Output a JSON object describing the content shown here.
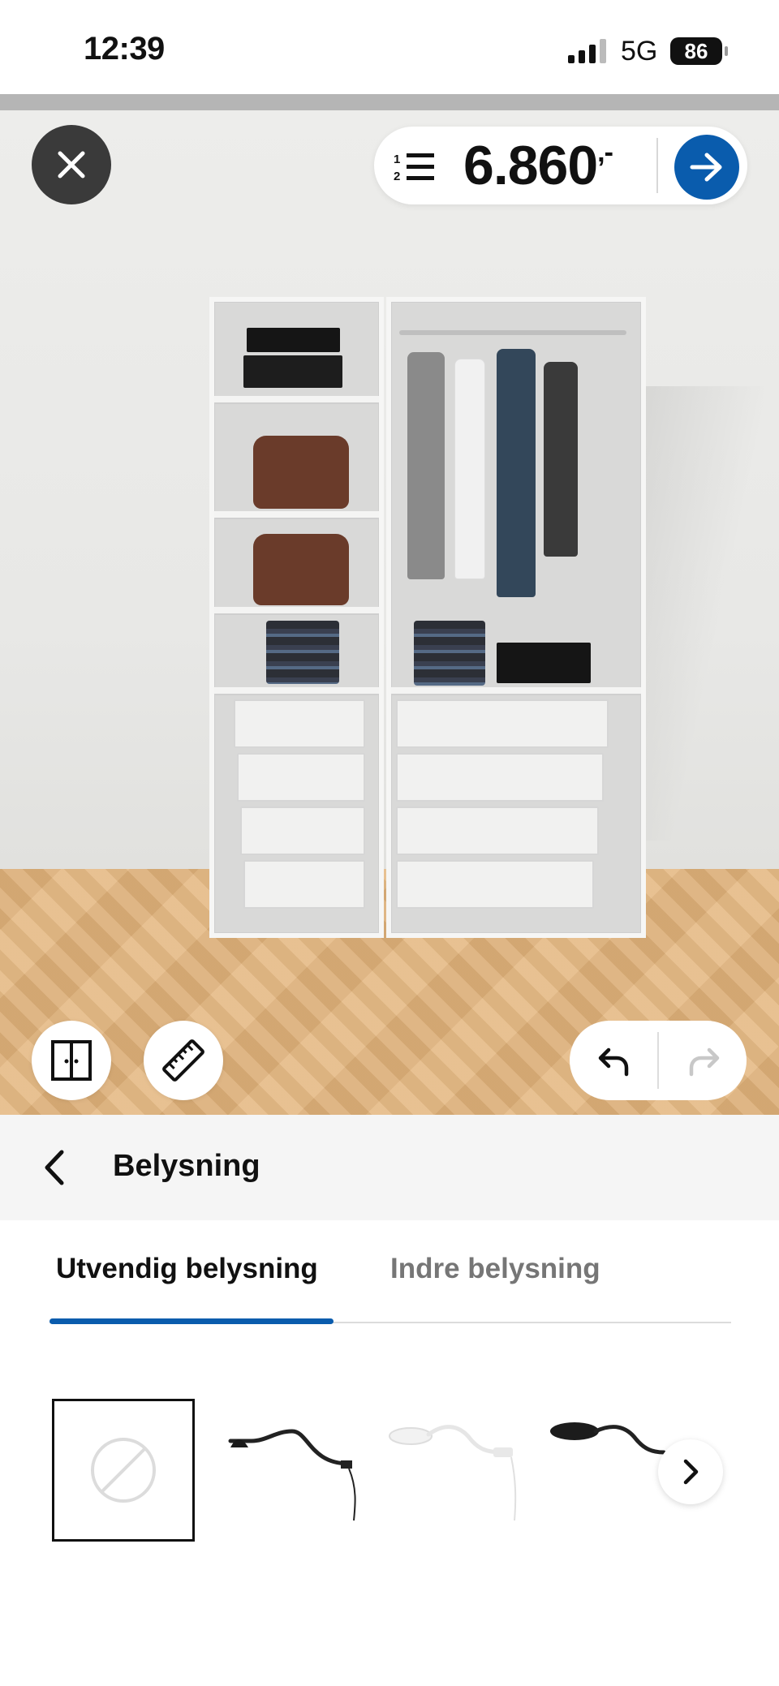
{
  "status_bar": {
    "time": "12:39",
    "network": "5G",
    "battery": "86"
  },
  "planner": {
    "price": "6.860",
    "price_suffix": ",-",
    "icons": {
      "close": "close-icon",
      "list": "numbered-list-icon",
      "proceed": "arrow-right-icon",
      "doors": "double-door-icon",
      "measure": "ruler-icon",
      "undo": "undo-icon",
      "redo": "redo-icon"
    },
    "accent_color": "#0a5cad"
  },
  "section": {
    "title": "Belysning",
    "back_icon": "chevron-left-icon"
  },
  "tabs": [
    {
      "label": "Utvendig belysning",
      "active": true
    },
    {
      "label": "Indre belysning",
      "active": false
    }
  ],
  "options": [
    {
      "name": "none-option",
      "icon": "no-symbol-icon",
      "selected": true
    },
    {
      "name": "lamp-black-option",
      "icon": "wall-lamp-black-icon",
      "selected": false
    },
    {
      "name": "lamp-white-option",
      "icon": "wall-lamp-white-icon",
      "selected": false
    },
    {
      "name": "lamp-black-flat-option",
      "icon": "wall-lamp-black-flat-icon",
      "selected": false
    }
  ]
}
